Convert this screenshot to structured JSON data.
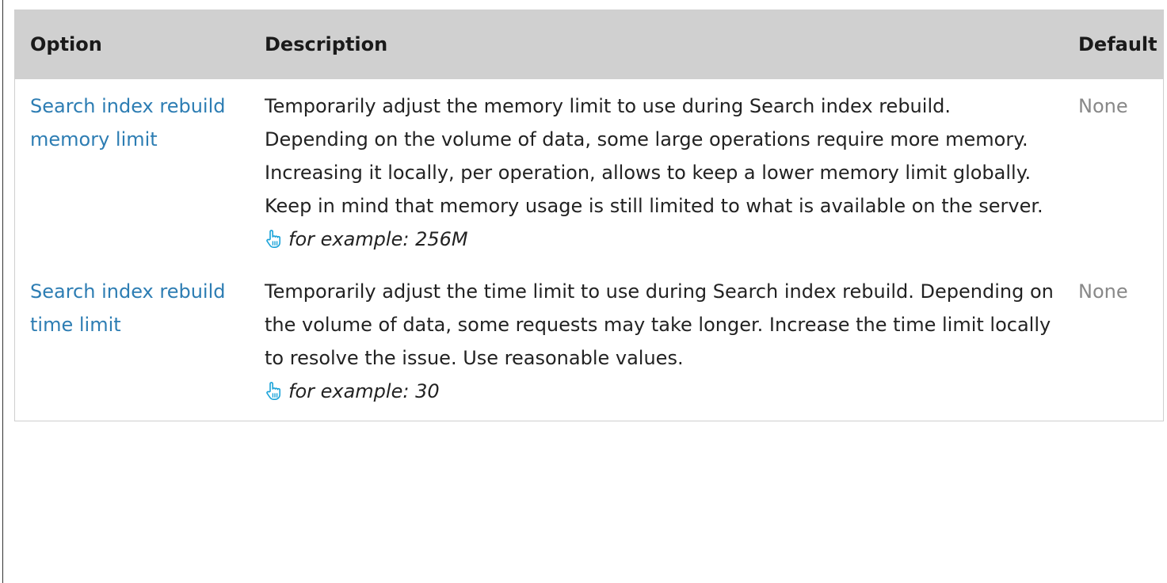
{
  "table": {
    "headers": {
      "option": "Option",
      "description": "Description",
      "default": "Default"
    },
    "rows": [
      {
        "option": "Search index rebuild memory limit",
        "description": "Temporarily adjust the memory limit to use during Search index rebuild. Depending on the volume of data, some large operations require more memory. Increasing it locally, per operation, allows to keep a lower memory limit globally. Keep in mind that memory usage is still limited to what is available on the server.",
        "example": "for example: 256M",
        "default": "None"
      },
      {
        "option": "Search index rebuild time limit",
        "description": "Temporarily adjust the time limit to use during Search index rebuild. Depending on the volume of data, some requests may take longer. Increase the time limit locally to resolve the issue. Use reasonable values.",
        "example": "for example: 30",
        "default": "None"
      }
    ]
  },
  "colors": {
    "link": "#2d7db3",
    "header_bg": "#d0d0d0",
    "icon": "#1aa3d9",
    "default_text": "#888888"
  },
  "icons": {
    "example_icon": "pointing-hand-icon"
  }
}
